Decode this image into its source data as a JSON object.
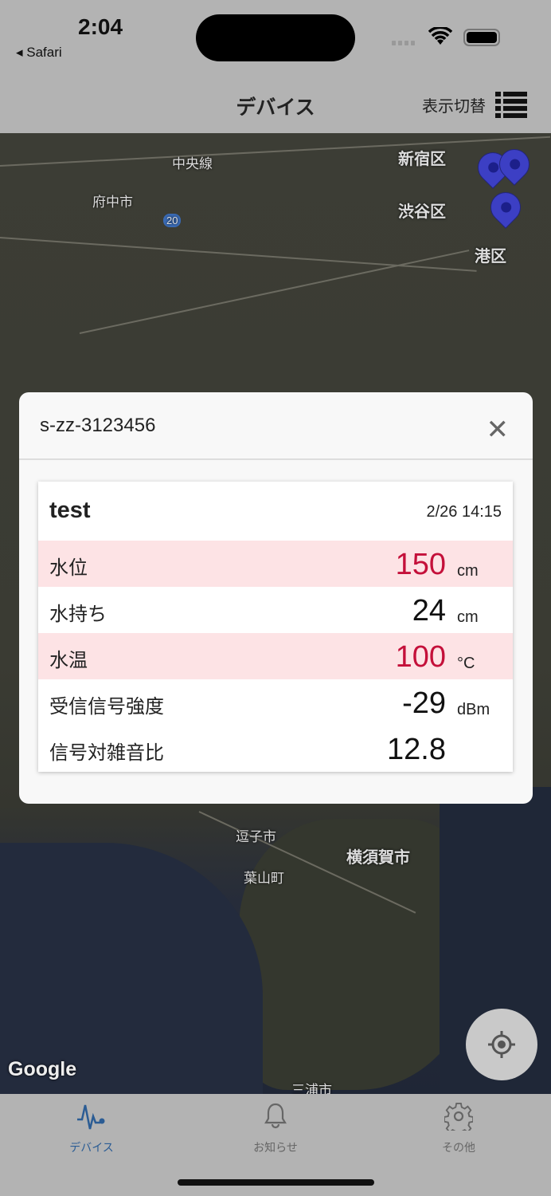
{
  "status_bar": {
    "time": "2:04",
    "back_app": "Safari"
  },
  "nav": {
    "title": "デバイス",
    "toggle_label": "表示切替"
  },
  "map": {
    "labels": {
      "chuo_line": "中央線",
      "fuchu": "府中市",
      "route": "20",
      "shinjuku": "新宿区",
      "shibuya": "渋谷区",
      "minato": "港区",
      "zushi": "逗子市",
      "hayama": "葉山町",
      "yokosuka": "横須賀市",
      "miura": "三浦市"
    },
    "attribution": "Google"
  },
  "modal": {
    "device_id": "s-zz-3123456",
    "card": {
      "name": "test",
      "timestamp": "2/26 14:15",
      "rows": [
        {
          "label": "水位",
          "value": "150",
          "unit": "cm",
          "alert": true
        },
        {
          "label": "水持ち",
          "value": "24",
          "unit": "cm",
          "alert": false
        },
        {
          "label": "水温",
          "value": "100",
          "unit": "°C",
          "alert": true
        },
        {
          "label": "受信信号強度",
          "value": "-29",
          "unit": "dBm",
          "alert": false
        },
        {
          "label": "信号対雑音比",
          "value": "12.8",
          "unit": "",
          "alert": false
        }
      ]
    }
  },
  "tabs": [
    {
      "label": "デバイス",
      "active": true
    },
    {
      "label": "お知らせ",
      "active": false
    },
    {
      "label": "その他",
      "active": false
    }
  ],
  "colors": {
    "alert_bg": "#fde3e5",
    "alert_text": "#c4103a",
    "tab_active": "#2b5c94",
    "pin": "#3c3fc4"
  }
}
